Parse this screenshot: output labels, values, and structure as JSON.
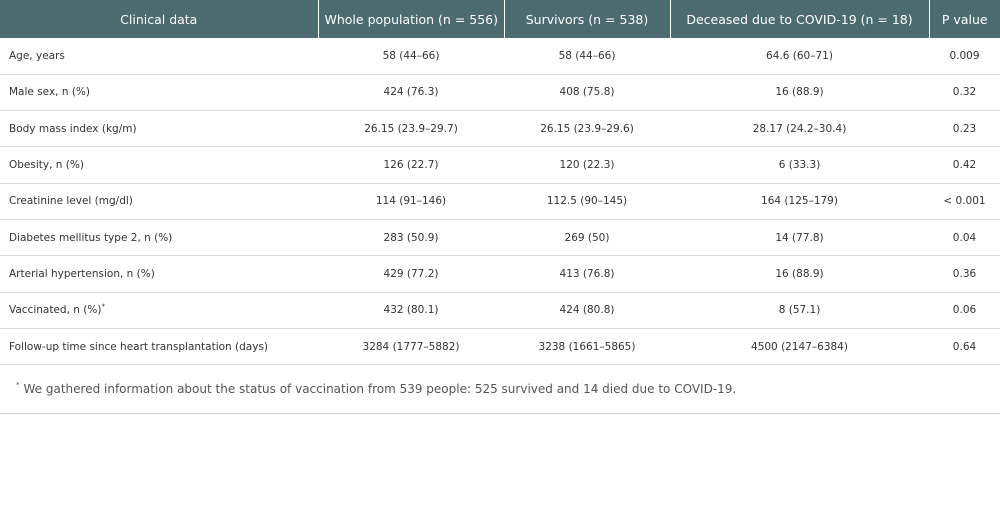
{
  "table": {
    "headers": [
      "Clinical data",
      "Whole population (n = 556)",
      "Survivors (n = 538)",
      "Deceased due to COVID-19 (n = 18)",
      "P value"
    ],
    "rows": [
      {
        "label": "Age, years",
        "whole": "58 (44–66)",
        "survivors": "58 (44–66)",
        "deceased": "64.6 (60–71)",
        "p": "0.009"
      },
      {
        "label": "Male sex, n (%)",
        "whole": "424 (76.3)",
        "survivors": "408 (75.8)",
        "deceased": "16 (88.9)",
        "p": "0.32"
      },
      {
        "label": "Body mass index (kg/m)",
        "whole": "26.15 (23.9–29.7)",
        "survivors": "26.15 (23.9–29.6)",
        "deceased": "28.17 (24.2–30.4)",
        "p": "0.23"
      },
      {
        "label": "Obesity, n (%)",
        "whole": "126 (22.7)",
        "survivors": "120 (22.3)",
        "deceased": "6 (33.3)",
        "p": "0.42"
      },
      {
        "label": "Creatinine level (mg/dl)",
        "whole": "114 (91–146)",
        "survivors": "112.5 (90–145)",
        "deceased": "164 (125–179)",
        "p": "< 0.001"
      },
      {
        "label": "Diabetes mellitus type 2, n (%)",
        "whole": "283 (50.9)",
        "survivors": "269 (50)",
        "deceased": "14 (77.8)",
        "p": "0.04"
      },
      {
        "label": "Arterial hypertension, n (%)",
        "whole": "429 (77.2)",
        "survivors": "413 (76.8)",
        "deceased": "16 (88.9)",
        "p": "0.36"
      },
      {
        "label": "Vaccinated, n (%)",
        "label_mark": "*",
        "whole": "432 (80.1)",
        "survivors": "424 (80.8)",
        "deceased": "8 (57.1)",
        "p": "0.06"
      },
      {
        "label": "Follow-up time since heart transplantation (days)",
        "whole": "3284 (1777–5882)",
        "survivors": "3238 (1661–5865)",
        "deceased": "4500 (2147–6384)",
        "p": "0.64"
      }
    ]
  },
  "footnote": {
    "mark": "*",
    "text": "We gathered information about the status of vaccination from 539 people: 525 survived and 14 died due to COVID-19."
  }
}
